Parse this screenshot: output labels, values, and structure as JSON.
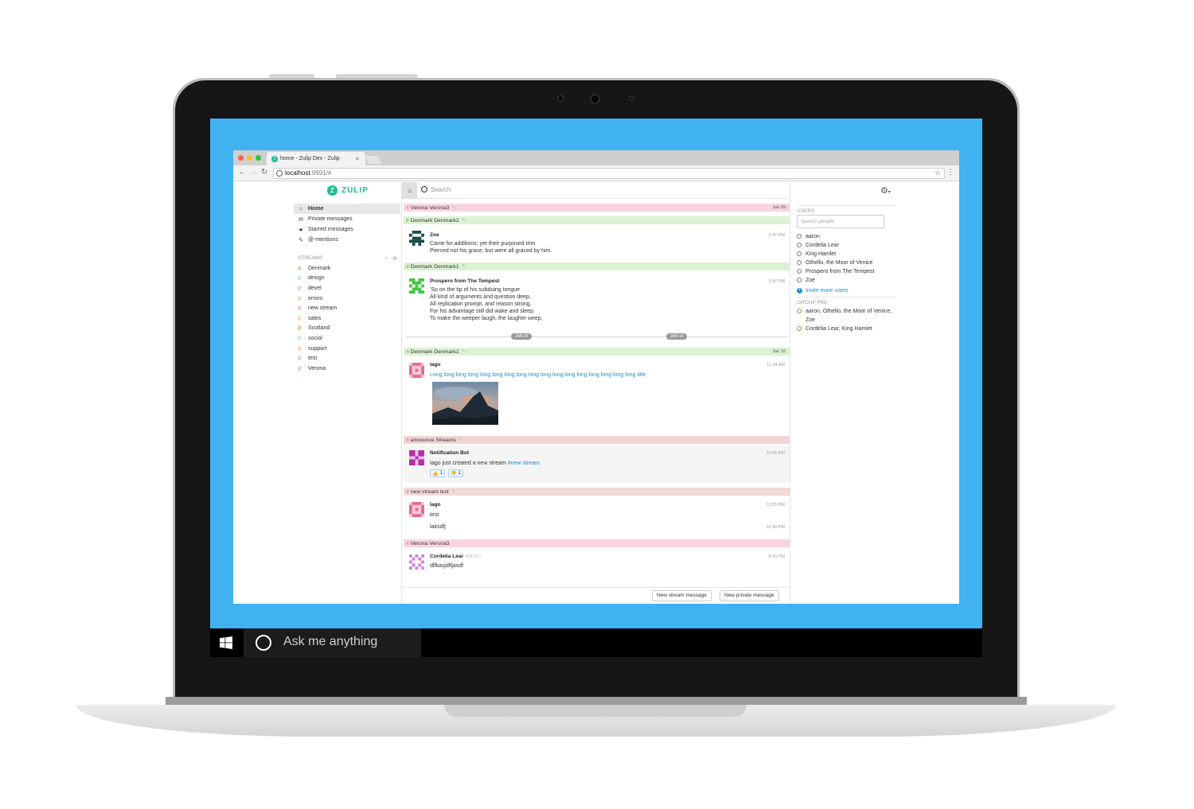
{
  "taskbar": {
    "search_placeholder": "Ask me anything"
  },
  "browser": {
    "tab_title": "home - Zulip Dev - Zulip",
    "tab_close": "×",
    "url_host": "localhost",
    "url_rest": ":9991/#",
    "back": "←",
    "forward": "→",
    "reload": "↻",
    "star": "☆",
    "menu": "⋮"
  },
  "zulip": {
    "logo_text": "ZULIP",
    "logo_mark": "Z",
    "search_placeholder": "Search",
    "nav": [
      {
        "label": "Home",
        "icon": "home-icon",
        "glyph": "⌂"
      },
      {
        "label": "Private messages",
        "icon": "envelope-icon",
        "glyph": "✉"
      },
      {
        "label": "Starred messages",
        "icon": "star-icon",
        "glyph": "★"
      },
      {
        "label": "@-mentions",
        "icon": "tag-icon",
        "glyph": "✎"
      }
    ],
    "streams_header": "STREAMS",
    "streams": [
      {
        "name": "Denmark",
        "color": "#76ce90"
      },
      {
        "name": "design",
        "color": "#a6c7e5"
      },
      {
        "name": "devel",
        "color": "#c2a8ea"
      },
      {
        "name": "errors",
        "color": "#e4b07d"
      },
      {
        "name": "new stream",
        "color": "#e79ab5"
      },
      {
        "name": "sales",
        "color": "#f5ce6e"
      },
      {
        "name": "Scotland",
        "color": "#e39a4f"
      },
      {
        "name": "social",
        "color": "#a8d8e8"
      },
      {
        "name": "support",
        "color": "#f2b36e"
      },
      {
        "name": "test",
        "color": "#9bcf8e"
      },
      {
        "name": "Verona",
        "color": "#e79ab5"
      }
    ],
    "messages": {
      "h1": {
        "stream": "Verona",
        "topic": "Verona3",
        "date": "Jan 09"
      },
      "h2": {
        "stream": "Denmark",
        "topic": "Denmark2"
      },
      "m1": {
        "sender": "Zoe",
        "time": "2:47 PM",
        "lines": [
          "Came for additions; yet their purposed trim",
          "Pierced not his grace, but were all graced by him."
        ]
      },
      "h3": {
        "stream": "Denmark",
        "topic": "Denmark1"
      },
      "m2": {
        "sender": "Prospero from The Tempest",
        "time": "2:47 PM",
        "lines": [
          "'So on the tip of his subduing tongue",
          "All kind of arguments and question deep,",
          "All replication prompt, and reason strong,",
          "For his advantage still did wake and sleep.",
          "To make the weeper laugh, the laugher weep,"
        ]
      },
      "date_pill_left": "JAN 09",
      "date_pill_right": "JAN 10",
      "h4": {
        "stream": "Denmark",
        "topic": "Denmark1",
        "date": "Jan 10"
      },
      "m3": {
        "sender": "Iago",
        "time": "11:34 AM",
        "link": "Long long long long long long long long long long long long long long long long long title"
      },
      "h5": {
        "stream": "announce",
        "topic": "Streams"
      },
      "m4": {
        "sender": "Notification Bot",
        "time": "12:05 PM",
        "text": "Iago just created a new stream ",
        "link": "#new stream",
        "text_end": ".",
        "reactions": [
          {
            "emoji": "👍",
            "count": "1"
          },
          {
            "emoji": "👎",
            "count": "1"
          }
        ]
      },
      "h6": {
        "stream": "new stream",
        "topic": "test"
      },
      "m5": {
        "sender": "Iago",
        "time": "12:05 PM",
        "text": "test"
      },
      "m6": {
        "time": "12:49 PM",
        "text": "laksdfj"
      },
      "h7": {
        "stream": "Verona",
        "topic": "Verona3"
      },
      "m7": {
        "sender": "Cordelia Lear",
        "sender_note": "(IDE150)",
        "time": "6:16 PM",
        "text": "dlfkasjdlfjasdf"
      }
    },
    "compose": {
      "new_stream": "New stream message",
      "new_private": "New private message"
    },
    "users_header": "USERS",
    "search_people": "Search people",
    "users": [
      "aaron",
      "Cordelia Lear",
      "King Hamlet",
      "Othello, the Moor of Venice",
      "Prospero from The Tempest",
      "Zoe"
    ],
    "invite": "Invite more users",
    "group_pms_header": "GROUP PMs",
    "group_pms": [
      "aaron, Othello, the Moor of Venice,",
      "Zoe",
      "Cordelia Lear, King Hamlet"
    ],
    "colors": {
      "accent": "#1dbc95",
      "link": "#1b8fc8",
      "screen_bg": "#40b2f2",
      "verona_hdr": "#f9d4de",
      "denmark_hdr": "#dcf2d3",
      "announce_hdr": "#f0d6d6",
      "newstream_hdr": "#f2dada"
    }
  }
}
